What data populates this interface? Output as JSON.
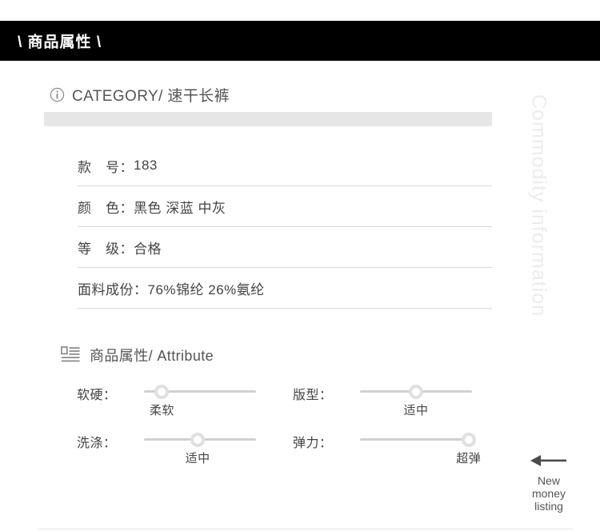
{
  "banner": {
    "title": "\\ 商品属性 \\"
  },
  "category": {
    "icon": "info-circle-icon",
    "text": "CATEGORY/ 速干长裤"
  },
  "specs": {
    "rows": [
      {
        "label": "款　号：",
        "value": "183"
      },
      {
        "label": "颜　色：",
        "value": "黑色 深蓝 中灰"
      },
      {
        "label": "等　级：",
        "value": "合格"
      },
      {
        "label": "面料成份：",
        "value": " 76%锦纶 26%氨纶"
      }
    ]
  },
  "attribute_section": {
    "icon": "article-list-icon",
    "title": "商品属性/ Attribute",
    "sliders": [
      {
        "label": "软硬：",
        "value": "柔软",
        "position": 16
      },
      {
        "label": "版型：",
        "value": "适中",
        "position": 50
      },
      {
        "label": "洗涤：",
        "value": "适中",
        "position": 48
      },
      {
        "label": "弹力：",
        "value": "超弹",
        "position": 97
      }
    ]
  },
  "watermark": {
    "text": "Commodity information"
  },
  "arrow_note": {
    "icon": "arrow-left-icon",
    "line1": "New",
    "line2": "money",
    "line3": "listing"
  },
  "colors": {
    "banner_bg": "#000000",
    "banner_text": "#ffffff",
    "body_text": "#444444",
    "gray_bar": "#e6e6e6",
    "divider": "#d8d8d8",
    "slider_track": "#d0d0d0",
    "slider_knob": "#e0e0e0",
    "watermark": "#ececec"
  }
}
